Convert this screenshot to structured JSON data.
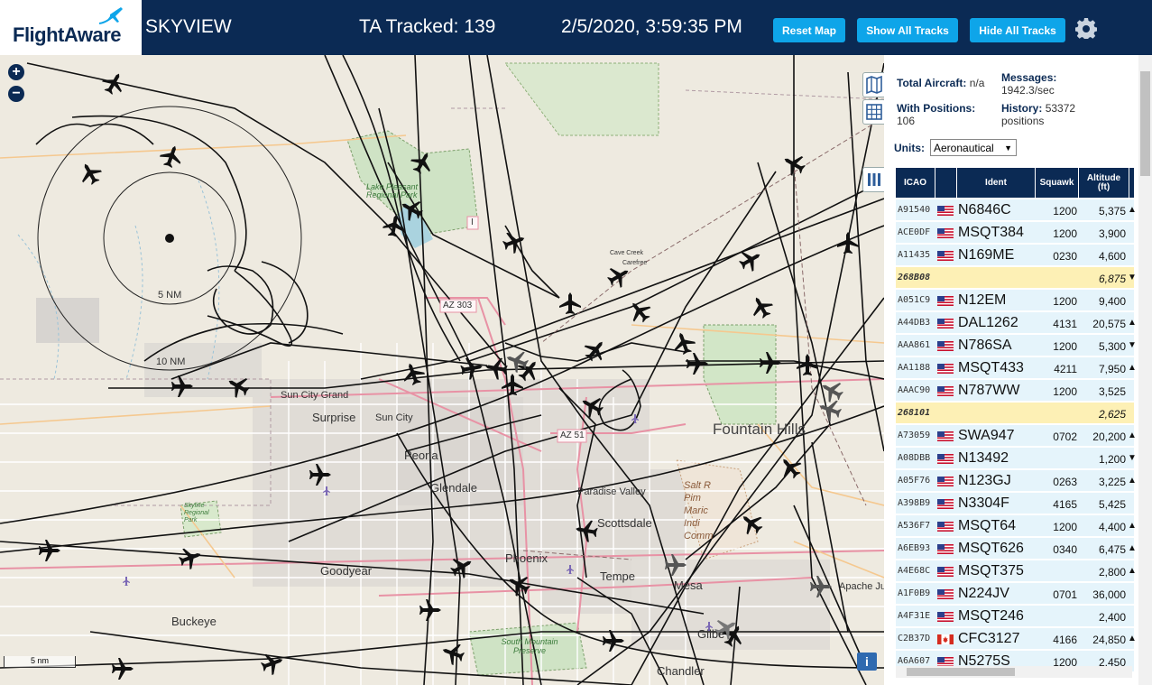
{
  "header": {
    "logo_text": "FlightAware",
    "app_name": "SKYVIEW",
    "tracked": "TA Tracked: 139",
    "datetime": "2/5/2020, 3:59:35 PM",
    "buttons": {
      "reset": "Reset Map",
      "show": "Show All Tracks",
      "hide": "Hide All Tracks"
    },
    "settings_icon": "gear-icon"
  },
  "map": {
    "zoom_in": "+",
    "zoom_out": "−",
    "ring_labels": {
      "inner": "5 NM",
      "outer": "10 NM"
    },
    "scale": "5 nm",
    "info": "i",
    "places": {
      "sun_city_grand": "Sun City Grand",
      "surprise": "Surprise",
      "sun_city": "Sun City",
      "peoria": "Peoria",
      "glendale": "Glendale",
      "paradise_valley": "Paradise Valley",
      "scottsdale": "Scottsdale",
      "phoenix": "Phoenix",
      "goodyear": "Goodyear",
      "tempe": "Tempe",
      "mesa": "Mesa",
      "apache": "Apache Ju",
      "buckeye": "Buckeye",
      "gilbert": "Gilbe",
      "chandler": "Chandler",
      "fountain_hills": "Fountain Hills",
      "cave_creek": "Cave Creek",
      "carefree": "Carefree",
      "lake_pleasant": "Lake Pleasant Regional Park",
      "south_mountain": "South Mountain Preserve",
      "salt_river": "Salt R Pim Maric Indi Comm",
      "skyline": "Skyline Regional Park",
      "az51": "AZ 51",
      "az303": "AZ 303",
      "i17": "I"
    }
  },
  "stats": {
    "total_label": "Total Aircraft:",
    "total_value": "n/a",
    "messages_label": "Messages:",
    "messages_value": "1942.3/sec",
    "positions_label": "With Positions:",
    "positions_value": "106",
    "history_label": "History:",
    "history_value": "53372",
    "history_unit": "positions"
  },
  "units": {
    "label": "Units:",
    "selected": "Aeronautical"
  },
  "table": {
    "headers": {
      "icao": "ICAO",
      "ident": "Ident",
      "squawk": "Squawk",
      "altitude": "Altitude",
      "altitude_unit": "(ft)"
    },
    "rows": [
      {
        "icao": "A91540",
        "flag": "us",
        "ident": "N6846C",
        "squawk": "1200",
        "alt": "5,375",
        "arrow": "▲",
        "alert": false
      },
      {
        "icao": "ACE0DF",
        "flag": "us",
        "ident": "MSQT384",
        "squawk": "1200",
        "alt": "3,900",
        "arrow": "",
        "alert": false
      },
      {
        "icao": "A11435",
        "flag": "us",
        "ident": "N169ME",
        "squawk": "0230",
        "alt": "4,600",
        "arrow": "",
        "alert": false
      },
      {
        "icao": "268B08",
        "flag": "",
        "ident": "",
        "squawk": "",
        "alt": "6,875",
        "arrow": "▼",
        "alert": true
      },
      {
        "icao": "A051C9",
        "flag": "us",
        "ident": "N12EM",
        "squawk": "1200",
        "alt": "9,400",
        "arrow": "",
        "alert": false
      },
      {
        "icao": "A44DB3",
        "flag": "us",
        "ident": "DAL1262",
        "squawk": "4131",
        "alt": "20,575",
        "arrow": "▲",
        "alert": false
      },
      {
        "icao": "AAA861",
        "flag": "us",
        "ident": "N786SA",
        "squawk": "1200",
        "alt": "5,300",
        "arrow": "▼",
        "alert": false
      },
      {
        "icao": "AA1188",
        "flag": "us",
        "ident": "MSQT433",
        "squawk": "4211",
        "alt": "7,950",
        "arrow": "▲",
        "alert": false
      },
      {
        "icao": "AAAC90",
        "flag": "us",
        "ident": "N787WW",
        "squawk": "1200",
        "alt": "3,525",
        "arrow": "",
        "alert": false
      },
      {
        "icao": "268101",
        "flag": "",
        "ident": "",
        "squawk": "",
        "alt": "2,625",
        "arrow": "",
        "alert": true
      },
      {
        "icao": "A73059",
        "flag": "us",
        "ident": "SWA947",
        "squawk": "0702",
        "alt": "20,200",
        "arrow": "▲",
        "alert": false
      },
      {
        "icao": "A08DBB",
        "flag": "us",
        "ident": "N13492",
        "squawk": "",
        "alt": "1,200",
        "arrow": "▼",
        "alert": false
      },
      {
        "icao": "A05F76",
        "flag": "us",
        "ident": "N123GJ",
        "squawk": "0263",
        "alt": "3,225",
        "arrow": "▲",
        "alert": false
      },
      {
        "icao": "A398B9",
        "flag": "us",
        "ident": "N3304F",
        "squawk": "4165",
        "alt": "5,425",
        "arrow": "",
        "alert": false
      },
      {
        "icao": "A536F7",
        "flag": "us",
        "ident": "MSQT64",
        "squawk": "1200",
        "alt": "4,400",
        "arrow": "▲",
        "alert": false
      },
      {
        "icao": "A6EB93",
        "flag": "us",
        "ident": "MSQT626",
        "squawk": "0340",
        "alt": "6,475",
        "arrow": "▲",
        "alert": false
      },
      {
        "icao": "A4E68C",
        "flag": "us",
        "ident": "MSQT375",
        "squawk": "",
        "alt": "2,800",
        "arrow": "▲",
        "alert": false
      },
      {
        "icao": "A1F0B9",
        "flag": "us",
        "ident": "N224JV",
        "squawk": "0701",
        "alt": "36,000",
        "arrow": "",
        "alert": false
      },
      {
        "icao": "A4F31E",
        "flag": "us",
        "ident": "MSQT246",
        "squawk": "",
        "alt": "2,400",
        "arrow": "",
        "alert": false
      },
      {
        "icao": "C2B37D",
        "flag": "ca",
        "ident": "CFC3127",
        "squawk": "4166",
        "alt": "24,850",
        "arrow": "▲",
        "alert": false
      },
      {
        "icao": "A6A607",
        "flag": "us",
        "ident": "N5275S",
        "squawk": "1200",
        "alt": "2,450",
        "arrow": "",
        "alert": false
      }
    ]
  },
  "colors": {
    "navy": "#0b2a54",
    "button": "#0ea5e9",
    "row": "#e5f4fb",
    "alert_row": "#fdf0b5"
  }
}
